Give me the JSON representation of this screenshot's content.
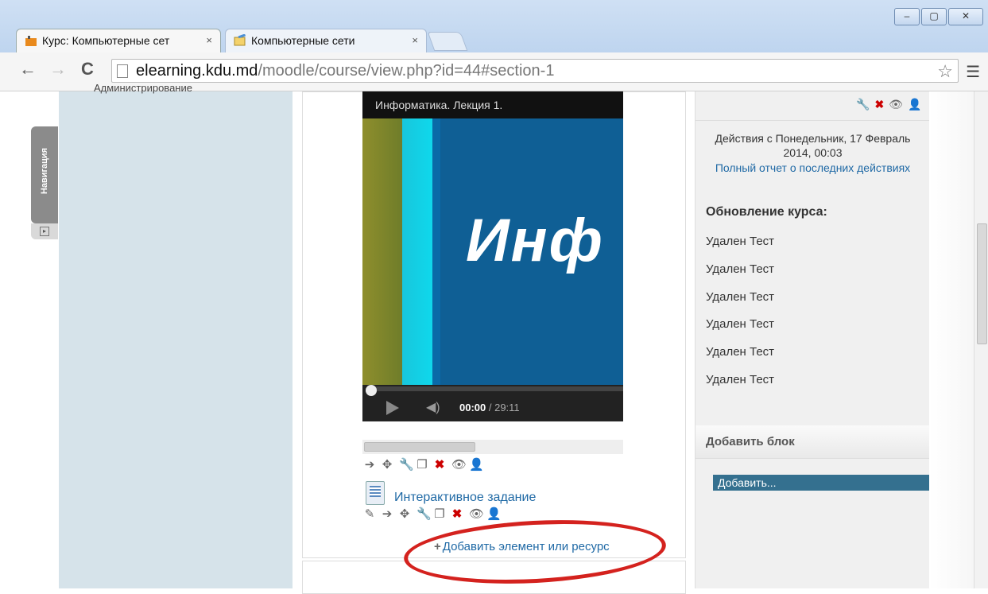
{
  "browser": {
    "tabs": [
      {
        "label": "Курс: Компьютерные сет",
        "icon": "moodle-icon",
        "active": true
      },
      {
        "label": "Компьютерные сети",
        "icon": "document-pencil-icon",
        "active": false
      }
    ],
    "tab_close": "×",
    "url_host": "elearning.kdu.md",
    "url_path": "/moodle/course/view.php?id=44#section-1",
    "window_controls": [
      "minimize-icon",
      "maximize-icon",
      "close-icon"
    ]
  },
  "navigation_tab": {
    "label": "Навигация"
  },
  "left_column": {
    "admin_label": "Администрирование"
  },
  "video": {
    "title": "Информатика. Лекция 1.",
    "frame_text": "Инф",
    "current_time": "00:00",
    "duration": "/ 29:11",
    "progress": 0
  },
  "activity": {
    "link_label": "Интерактивное задание"
  },
  "add_resource": {
    "label": "Добавить элемент или ресурс",
    "plus": "+"
  },
  "recent_activity": {
    "since": "Действия с Понедельник, 17 Февраль 2014, 00:03",
    "full_report_link": "Полный отчет о последних действиях",
    "heading": "Обновление курса:",
    "items": [
      "Удален Тест",
      "Удален Тест",
      "Удален Тест",
      "Удален Тест",
      "Удален Тест",
      "Удален Тест"
    ]
  },
  "add_block": {
    "heading": "Добавить блок",
    "select_value": "Добавить..."
  },
  "colors": {
    "link": "#1f69a5",
    "highlight": "#d4221e",
    "select": "#34708f"
  }
}
